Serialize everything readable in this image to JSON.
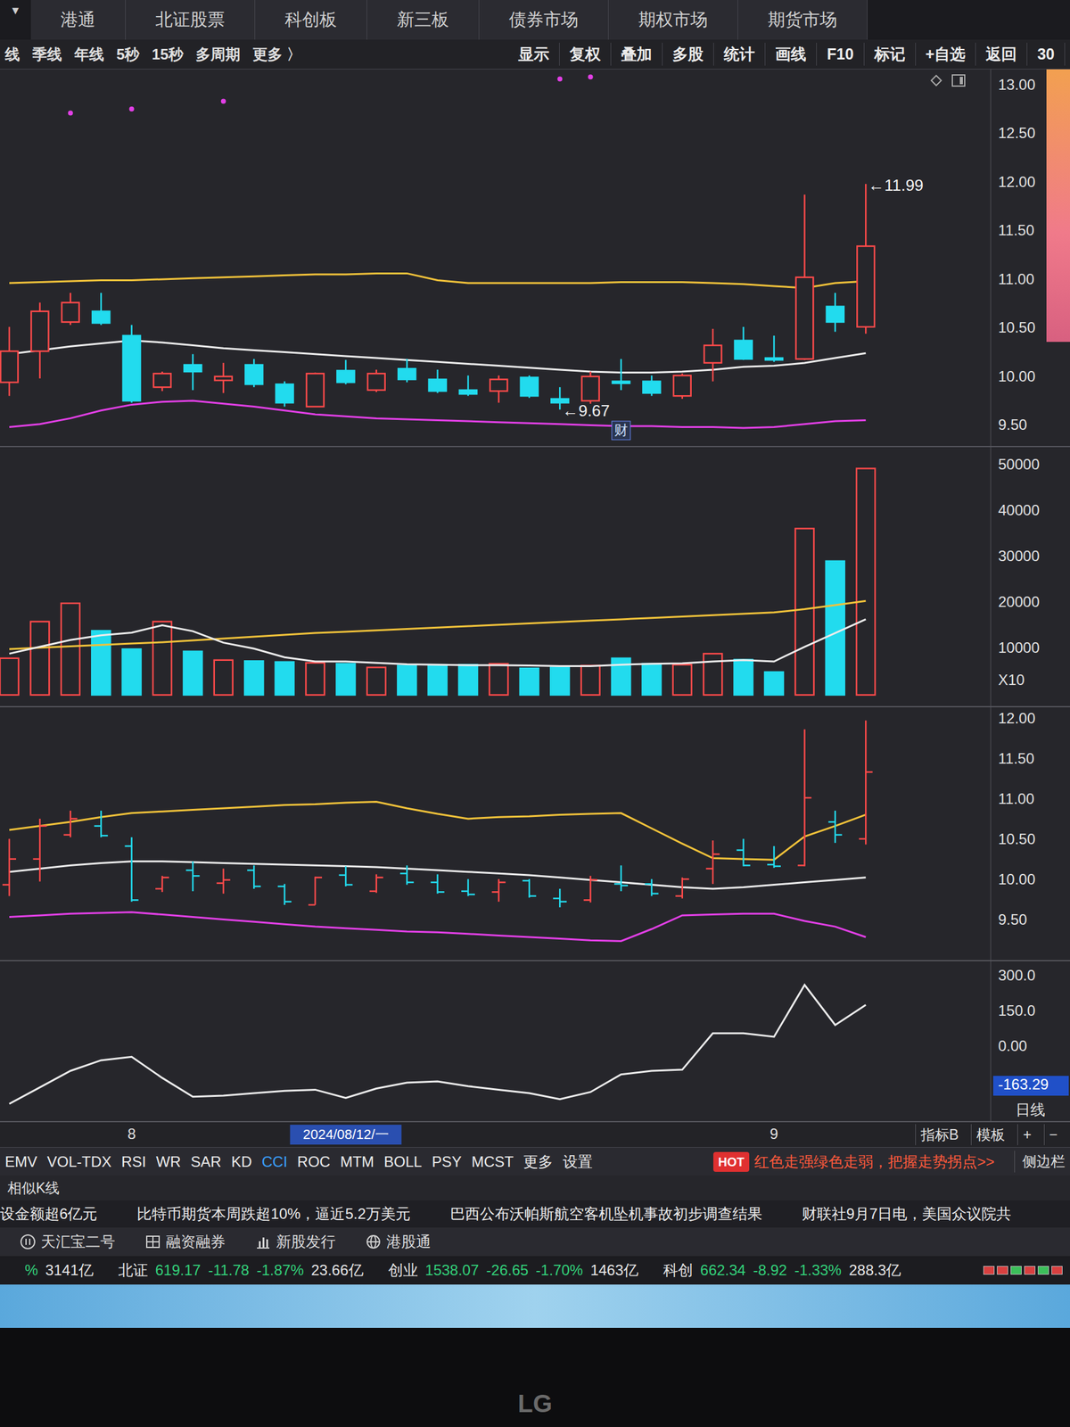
{
  "header": {
    "menu_glyph": "▼",
    "market_tabs": [
      {
        "label": "港通",
        "selected": false
      },
      {
        "label": "北证股票",
        "selected": false
      },
      {
        "label": "科创板",
        "selected": false
      },
      {
        "label": "新三板",
        "selected": false
      },
      {
        "label": "债券市场",
        "selected": false
      },
      {
        "label": "期权市场",
        "selected": false
      },
      {
        "label": "期货市场",
        "selected": false
      }
    ],
    "toolbar": [
      "显示",
      "复权",
      "叠加",
      "多股",
      "统计",
      "画线",
      "F10",
      "标记",
      "+自选",
      "返回",
      "30"
    ]
  },
  "periods": [
    "线",
    "季线",
    "年线",
    "5秒",
    "15秒",
    "多周期",
    "更多 〉"
  ],
  "main_chart": {
    "ticks": [
      "13.00",
      "12.50",
      "12.00",
      "11.50",
      "11.00",
      "10.50",
      "10.00",
      "9.50"
    ],
    "candles": [
      {
        "o": 9.95,
        "h": 10.52,
        "l": 9.81,
        "c": 10.27
      },
      {
        "o": 10.27,
        "h": 10.77,
        "l": 9.99,
        "c": 10.68
      },
      {
        "o": 10.57,
        "h": 10.87,
        "l": 10.54,
        "c": 10.77
      },
      {
        "o": 10.68,
        "h": 10.87,
        "l": 10.54,
        "c": 10.56
      },
      {
        "o": 10.43,
        "h": 10.54,
        "l": 9.74,
        "c": 9.76
      },
      {
        "o": 9.9,
        "h": 10.06,
        "l": 9.86,
        "c": 10.04
      },
      {
        "o": 10.13,
        "h": 10.24,
        "l": 9.87,
        "c": 10.06
      },
      {
        "o": 9.97,
        "h": 10.15,
        "l": 9.84,
        "c": 10.01
      },
      {
        "o": 10.13,
        "h": 10.19,
        "l": 9.9,
        "c": 9.93
      },
      {
        "o": 9.93,
        "h": 9.96,
        "l": 9.7,
        "c": 9.74
      },
      {
        "o": 9.7,
        "h": 10.05,
        "l": 9.7,
        "c": 10.04
      },
      {
        "o": 10.07,
        "h": 10.18,
        "l": 9.93,
        "c": 9.95
      },
      {
        "o": 9.87,
        "h": 10.08,
        "l": 9.85,
        "c": 10.04
      },
      {
        "o": 10.09,
        "h": 10.19,
        "l": 9.95,
        "c": 9.98
      },
      {
        "o": 9.98,
        "h": 10.08,
        "l": 9.84,
        "c": 9.86
      },
      {
        "o": 9.87,
        "h": 10.02,
        "l": 9.81,
        "c": 9.83
      },
      {
        "o": 9.86,
        "h": 10.02,
        "l": 9.74,
        "c": 9.98
      },
      {
        "o": 10.0,
        "h": 10.02,
        "l": 9.79,
        "c": 9.81
      },
      {
        "o": 9.78,
        "h": 9.9,
        "l": 9.67,
        "c": 9.74
      },
      {
        "o": 9.76,
        "h": 10.06,
        "l": 9.73,
        "c": 10.01
      },
      {
        "o": 9.96,
        "h": 10.19,
        "l": 9.87,
        "c": 9.94
      },
      {
        "o": 9.96,
        "h": 10.02,
        "l": 9.81,
        "c": 9.84
      },
      {
        "o": 9.81,
        "h": 10.04,
        "l": 9.78,
        "c": 10.02
      },
      {
        "o": 10.15,
        "h": 10.5,
        "l": 9.96,
        "c": 10.33
      },
      {
        "o": 10.38,
        "h": 10.52,
        "l": 10.18,
        "c": 10.19
      },
      {
        "o": 10.2,
        "h": 10.43,
        "l": 10.16,
        "c": 10.18
      },
      {
        "o": 10.19,
        "h": 11.88,
        "l": 10.18,
        "c": 11.03
      },
      {
        "o": 10.73,
        "h": 10.87,
        "l": 10.47,
        "c": 10.57
      },
      {
        "o": 10.52,
        "h": 11.99,
        "l": 10.45,
        "c": 11.35
      }
    ],
    "boll_upper": [
      10.97,
      10.98,
      10.99,
      11.0,
      11.0,
      11.01,
      11.02,
      11.03,
      11.04,
      11.05,
      11.06,
      11.06,
      11.07,
      11.07,
      11.0,
      10.97,
      10.97,
      10.97,
      10.97,
      10.97,
      10.98,
      10.98,
      10.98,
      10.97,
      10.96,
      10.94,
      10.92,
      10.97,
      10.99
    ],
    "boll_mid": [
      10.24,
      10.28,
      10.32,
      10.35,
      10.38,
      10.36,
      10.33,
      10.3,
      10.28,
      10.26,
      10.24,
      10.22,
      10.2,
      10.18,
      10.16,
      10.14,
      10.12,
      10.1,
      10.08,
      10.06,
      10.05,
      10.05,
      10.06,
      10.08,
      10.11,
      10.12,
      10.15,
      10.2,
      10.25
    ],
    "boll_lower": [
      9.49,
      9.52,
      9.58,
      9.66,
      9.72,
      9.75,
      9.76,
      9.73,
      9.7,
      9.66,
      9.62,
      9.6,
      9.58,
      9.57,
      9.56,
      9.55,
      9.54,
      9.53,
      9.52,
      9.51,
      9.5,
      9.5,
      9.49,
      9.49,
      9.48,
      9.49,
      9.52,
      9.55,
      9.56
    ],
    "high_label": {
      "arrow": "←",
      "text": "11.99",
      "index": 28
    },
    "low_label": {
      "arrow": "←",
      "text": "9.67",
      "index": 18
    },
    "event_badge": {
      "text": "财",
      "index": 20
    },
    "markers": [
      {
        "index": 2,
        "value": 12.72
      },
      {
        "index": 4,
        "value": 12.76
      },
      {
        "index": 7,
        "value": 12.84
      },
      {
        "index": 18,
        "value": 13.07
      },
      {
        "index": 19,
        "value": 13.09
      }
    ]
  },
  "volume_chart": {
    "ticks": [
      "50000",
      "40000",
      "30000",
      "20000",
      "10000"
    ],
    "multiplier": "X10",
    "volumes": [
      8000,
      16000,
      20000,
      14000,
      10000,
      16000,
      9500,
      7600,
      7400,
      7200,
      7000,
      6800,
      6000,
      6400,
      6600,
      6600,
      6800,
      5800,
      6000,
      6400,
      8000,
      6800,
      6600,
      9000,
      7700,
      5000,
      36300,
      29200,
      49400
    ],
    "ma_slow": [
      10000,
      10300,
      10600,
      10900,
      11200,
      11500,
      11900,
      12300,
      12700,
      13100,
      13500,
      13800,
      14100,
      14400,
      14700,
      15000,
      15300,
      15600,
      15900,
      16200,
      16500,
      16800,
      17100,
      17400,
      17700,
      18000,
      18700,
      19600,
      20500
    ],
    "ma_fast": [
      9000,
      10500,
      12000,
      13000,
      13600,
      15200,
      13900,
      11400,
      10100,
      8200,
      7300,
      7300,
      7000,
      6700,
      6600,
      6500,
      6500,
      6400,
      6300,
      6300,
      6600,
      6800,
      6900,
      7300,
      7600,
      7300,
      10500,
      13500,
      16500
    ]
  },
  "bar_chart": {
    "ticks": [
      "12.00",
      "11.50",
      "11.00",
      "10.50",
      "10.00",
      "9.50"
    ],
    "upper": [
      10.63,
      10.68,
      10.73,
      10.79,
      10.84,
      10.86,
      10.88,
      10.9,
      10.92,
      10.94,
      10.95,
      10.97,
      10.98,
      10.9,
      10.83,
      10.77,
      10.79,
      10.8,
      10.82,
      10.83,
      10.84,
      10.65,
      10.46,
      10.28,
      10.27,
      10.26,
      10.55,
      10.68,
      10.82
    ],
    "mid": [
      10.11,
      10.15,
      10.19,
      10.22,
      10.24,
      10.24,
      10.23,
      10.22,
      10.21,
      10.2,
      10.19,
      10.18,
      10.17,
      10.15,
      10.13,
      10.11,
      10.09,
      10.07,
      10.04,
      10.01,
      9.98,
      9.95,
      9.92,
      9.9,
      9.92,
      9.95,
      9.98,
      10.01,
      10.04
    ],
    "lower": [
      9.55,
      9.57,
      9.59,
      9.6,
      9.61,
      9.58,
      9.55,
      9.52,
      9.49,
      9.46,
      9.43,
      9.41,
      9.39,
      9.37,
      9.36,
      9.34,
      9.32,
      9.3,
      9.28,
      9.26,
      9.25,
      9.4,
      9.57,
      9.58,
      9.59,
      9.59,
      9.5,
      9.43,
      9.3
    ]
  },
  "cci_chart": {
    "ticks": [
      "300.0",
      "150.0",
      "0.00"
    ],
    "current": {
      "text": "-163.29",
      "value": -163.29
    },
    "values": [
      -240,
      -170,
      -100,
      -55,
      -40,
      -130,
      -210,
      -205,
      -195,
      -185,
      -180,
      -215,
      -175,
      -150,
      -145,
      -165,
      -180,
      -195,
      -220,
      -190,
      -115,
      -100,
      -95,
      60,
      60,
      45,
      265,
      95,
      180
    ]
  },
  "time_axis": {
    "labels": [
      {
        "text": "8",
        "index": 4
      },
      {
        "text": "9",
        "index": 25
      }
    ],
    "cursor_date": {
      "text": "2024/08/12/一",
      "index": 11
    },
    "period": "日线"
  },
  "indicator_tools": [
    "指标B",
    "模板",
    "+",
    "−"
  ],
  "indicator_tabs": [
    {
      "label": "EMV",
      "selected": false
    },
    {
      "label": "VOL-TDX",
      "selected": false
    },
    {
      "label": "RSI",
      "selected": false
    },
    {
      "label": "WR",
      "selected": false
    },
    {
      "label": "SAR",
      "selected": false
    },
    {
      "label": "KD",
      "selected": false
    },
    {
      "label": "CCI",
      "selected": true
    },
    {
      "label": "ROC",
      "selected": false
    },
    {
      "label": "MTM",
      "selected": false
    },
    {
      "label": "BOLL",
      "selected": false
    },
    {
      "label": "PSY",
      "selected": false
    },
    {
      "label": "MCST",
      "selected": false
    },
    {
      "label": "更多",
      "selected": false
    },
    {
      "label": "设置",
      "selected": false
    }
  ],
  "hot_banner": {
    "badge": "HOT",
    "text": "红色走强绿色走弱，把握走势拐点>>"
  },
  "sidebar_toggle": "侧边栏",
  "similar_k": "相似K线",
  "news": [
    "设金额超6亿元",
    "比特币期货本周跌超10%，逼近5.2万美元",
    "巴西公布沃帕斯航空客机坠机事故初步调查结果",
    "财联社9月7日电，美国众议院共"
  ],
  "tools": [
    {
      "label": "天汇宝二号",
      "kind": "coin"
    },
    {
      "label": "融资融券",
      "kind": "grid"
    },
    {
      "label": "新股发行",
      "kind": "bars"
    },
    {
      "label": "港股通",
      "kind": "globe"
    }
  ],
  "indices": [
    {
      "name": "",
      "price": "",
      "change": "",
      "pct": "%",
      "amount": "3141亿"
    },
    {
      "name": "北证",
      "price": "619.17",
      "change": "-11.78",
      "pct": "-1.87%",
      "amount": "23.66亿"
    },
    {
      "name": "创业",
      "price": "1538.07",
      "change": "-26.65",
      "pct": "-1.70%",
      "amount": "1463亿"
    },
    {
      "name": "科创",
      "price": "662.34",
      "change": "-8.92",
      "pct": "-1.33%",
      "amount": "288.3亿"
    }
  ],
  "signal_boxes": [
    {
      "color": "#d84040"
    },
    {
      "color": "#d84040"
    },
    {
      "color": "#3cbf5a"
    },
    {
      "color": "#d84040"
    },
    {
      "color": "#3cbf5a"
    },
    {
      "color": "#d84040"
    }
  ],
  "bezel": {
    "logo": "LG"
  }
}
